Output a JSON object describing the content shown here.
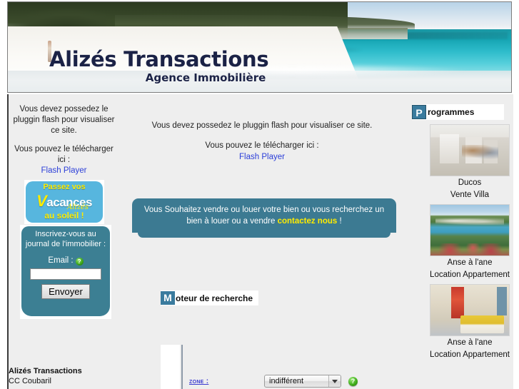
{
  "banner": {
    "logo_title": "Alizés Transactions",
    "logo_subtitle": "Agence Immobilière"
  },
  "left_sidebar": {
    "flash_line1": "Vous devez possedez le pluggin flash pour visualiser ce site.",
    "flash_line2": "Vous pouvez le télécharger ici :",
    "flash_link": "Flash Player",
    "vacation_banner": {
      "line1": "Passez vos",
      "word_v": "V",
      "word_rest": "acances",
      "script": "Alizés",
      "line4": "au soleil !"
    },
    "newsletter": {
      "heading": "Inscrivez-vous au journal de l'immobilier :",
      "email_label": "Email :",
      "help_glyph": "?",
      "email_value": "",
      "email_placeholder": "",
      "submit_label": "Envoyer"
    },
    "footer": {
      "company": "Alizés Transactions",
      "address": "CC Coubaril"
    }
  },
  "center": {
    "flash_line1": "Vous devez possedez le pluggin flash pour visualiser ce site.",
    "flash_line2": "Vous pouvez le télécharger ici :",
    "flash_link": "Flash Player",
    "promo": {
      "text_part1": "Vous Souhaitez vendre ou louer votre bien ou vous recherchez un bien à louer ou a vendre ",
      "highlight": "contactez nous",
      "text_part2": " !"
    },
    "search": {
      "badge_letter": "M",
      "title_rest": "oteur de recherche",
      "zone_label": "Zone :",
      "zone_value": "indifférent",
      "zone_options": [
        "indifférent"
      ],
      "help_glyph": "?"
    }
  },
  "right_sidebar": {
    "header_badge": "P",
    "header_rest": "rogrammes",
    "listings": [
      {
        "location": "Ducos",
        "type": "Vente Villa",
        "image": "villa-interior-photo"
      },
      {
        "location": "Anse à l'ane",
        "type": "Location Appartement",
        "image": "bay-view-photo"
      },
      {
        "location": "Anse à l'ane",
        "type": "Location Appartement",
        "image": "dining-room-photo"
      }
    ]
  },
  "colors": {
    "teal": "#3c7a92",
    "badge_blue": "#3a7b9e",
    "link_blue": "#2b3ed8",
    "highlight_yellow": "#ffec00",
    "page_bg": "#eeeeee"
  }
}
